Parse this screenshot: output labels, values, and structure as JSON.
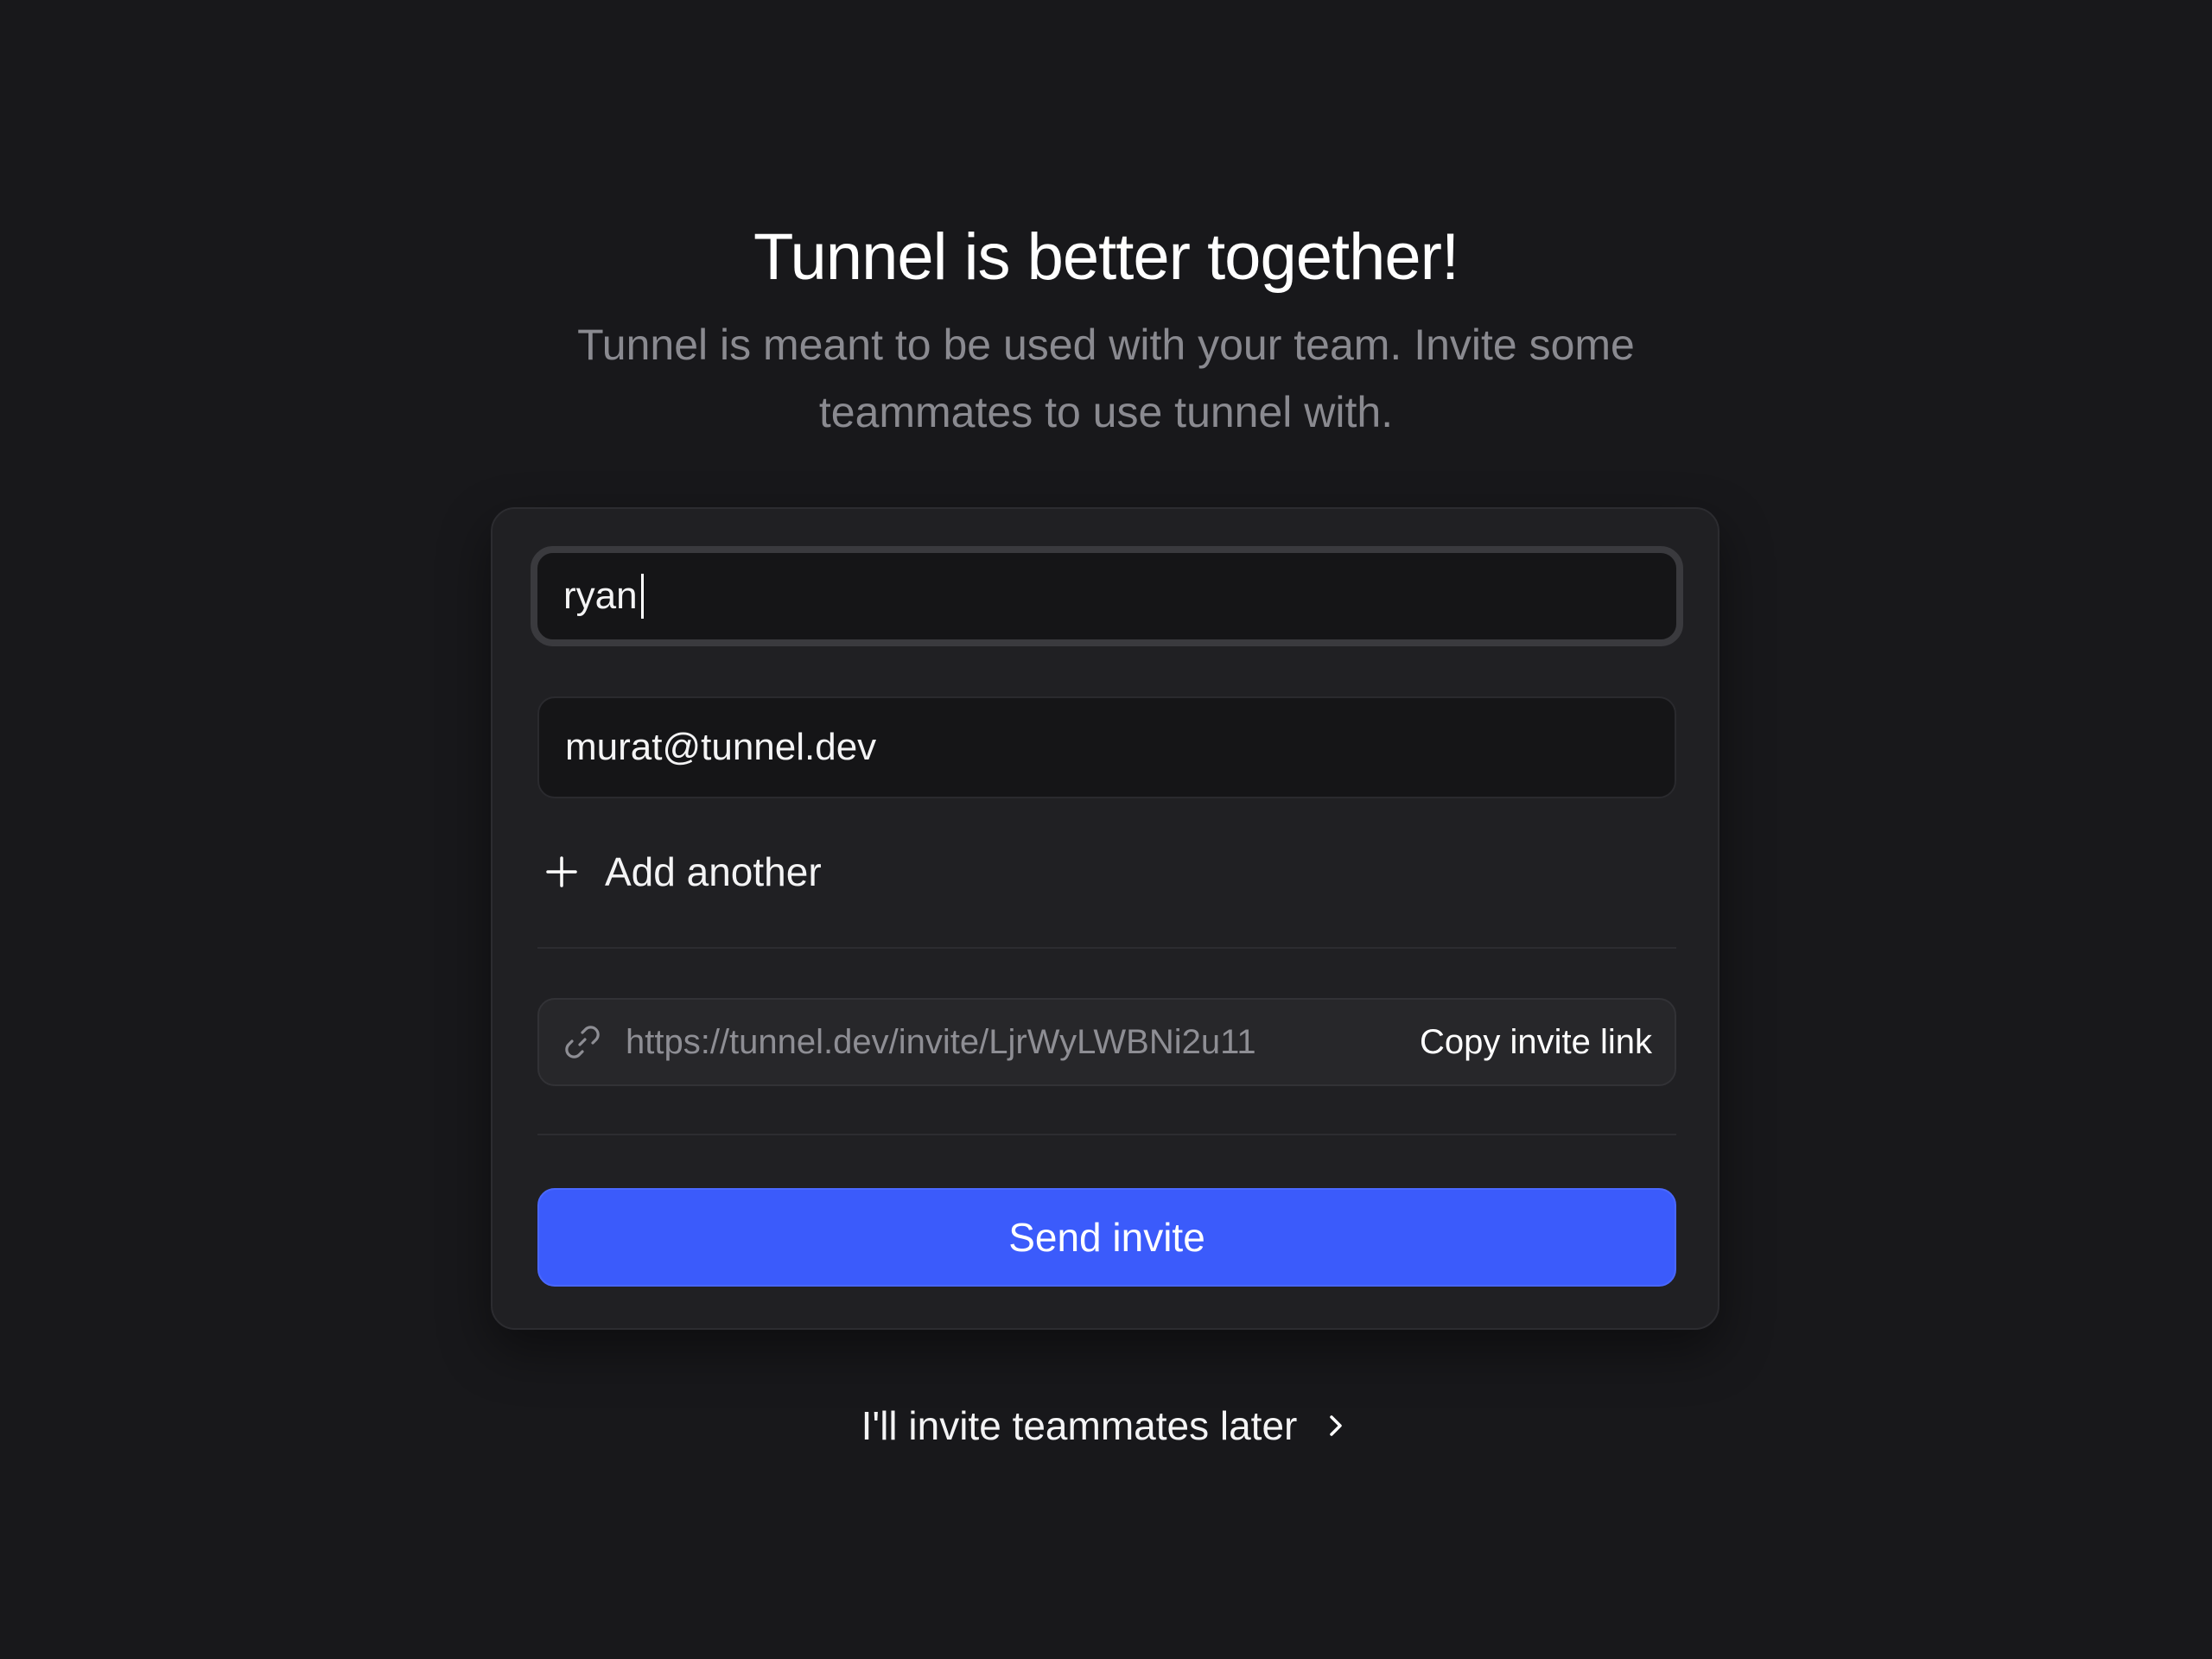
{
  "header": {
    "title": "Tunnel is better together!",
    "subtitle": "Tunnel is meant to be used with your team. Invite some teammates to use tunnel with."
  },
  "form": {
    "inputs": [
      {
        "value": "ryan",
        "focused": true
      },
      {
        "value": "murat@tunnel.dev",
        "focused": false
      }
    ],
    "add_another_label": "Add another",
    "invite_link": "https://tunnel.dev/invite/LjrWyLWBNi2u11",
    "copy_label": "Copy invite link",
    "send_label": "Send invite"
  },
  "footer": {
    "later_label": "I'll invite teammates later"
  },
  "icons": {
    "add": "plus-icon",
    "link": "link-icon",
    "later": "chevron-right-icon"
  },
  "colors": {
    "background": "#18181b",
    "card": "#202023",
    "primary": "#3b5bfb"
  }
}
